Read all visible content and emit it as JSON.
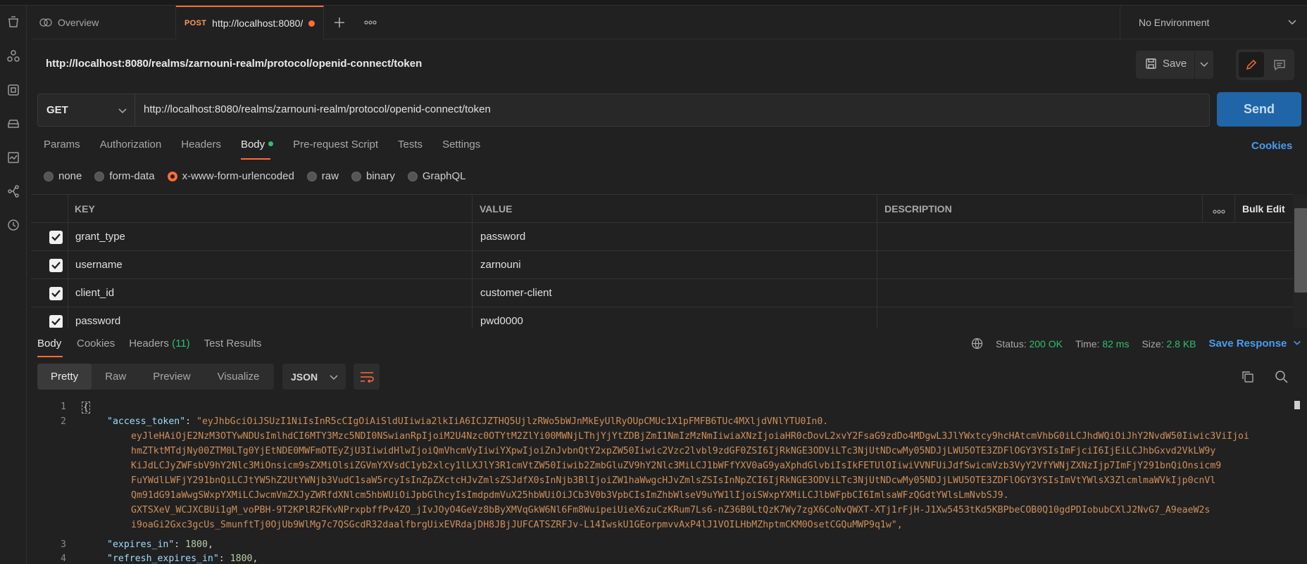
{
  "tabs": [
    {
      "label": "Overview"
    },
    {
      "method": "POST",
      "label": "http://localhost:8080/"
    }
  ],
  "environment": "No Environment",
  "request_title": "http://localhost:8080/realms/zarnouni-realm/protocol/openid-connect/token",
  "save_label": "Save",
  "method": "GET",
  "url": "http://localhost:8080/realms/zarnouni-realm/protocol/openid-connect/token",
  "send_label": "Send",
  "req_tabs": [
    "Params",
    "Authorization",
    "Headers",
    "Body",
    "Pre-request Script",
    "Tests",
    "Settings"
  ],
  "cookies_link": "Cookies",
  "body_types": [
    "none",
    "form-data",
    "x-www-form-urlencoded",
    "raw",
    "binary",
    "GraphQL"
  ],
  "selected_body_type": "x-www-form-urlencoded",
  "table": {
    "headers": [
      "KEY",
      "VALUE",
      "DESCRIPTION"
    ],
    "bulk_edit": "Bulk Edit",
    "rows": [
      {
        "key": "grant_type",
        "value": "password",
        "checked": true
      },
      {
        "key": "username",
        "value": "zarnouni",
        "checked": true
      },
      {
        "key": "client_id",
        "value": "customer-client",
        "checked": true
      },
      {
        "key": "password",
        "value": "pwd0000",
        "checked": true
      }
    ]
  },
  "response": {
    "tabs": [
      "Body",
      "Cookies",
      "Headers",
      "Test Results"
    ],
    "headers_count": "(11)",
    "status_label": "Status:",
    "status_value": "200 OK",
    "time_label": "Time:",
    "time_value": "82 ms",
    "size_label": "Size:",
    "size_value": "2.8 KB",
    "save_response": "Save Response",
    "views": [
      "Pretty",
      "Raw",
      "Preview",
      "Visualize"
    ],
    "format": "JSON"
  },
  "code": {
    "line_numbers": [
      "1",
      "2",
      "3",
      "4"
    ],
    "open_brace": "{",
    "access_token_key": "\"access_token\"",
    "access_token_lines": [
      "\"eyJhbGciOiJSUzI1NiIsInR5cCIgOiAiSldUIiwia2lkIiA6ICJZTHQ5UjlzRWo5bWJnMkEyUlRyOUpCMUc1X1pFMFB6TUc4MXljdVNlYTU0In0.",
      "eyJleHAiOjE2NzM3OTYwNDUsImlhdCI6MTY3Mzc5NDI0NSwianRpIjoiM2U4Nzc0OTYtM2ZlYi00MWNjLThjYjYtZDBjZmI1NmIzMzNmIiwiaXNzIjoiaHR0cDovL2xvY2FsaG9zdDo4MDgwL3JlYWxtcy9hcHAtcmVhbG0iLCJhdWQiOiJhY2NvdW50Iiwic3ViIjoi",
      "hmZTktMTdjNy00ZTM0LTg0YjEtNDE0MWFmOTEyZjU3IiwidHlwIjoiQmVhcmVyIiwiYXpwIjoiZnJvbnQtY2xpZW50Iiwic2Vzc2lvbl9zdGF0ZSI6IjRkNGE3ODViLTc3NjUtNDcwMy05NDJjLWU5OTE3ZDFlOGY3YSIsImFjciI6IjEiLCJhbGxvd2VkLW9y",
      "KiJdLCJyZWFsbV9hY2Nlc3MiOnsicm9sZXMiOlsiZGVmYXVsdC1yb2xlcy1lLXJlY3R1cmVtZW50Iiwib2ZmbGluZV9hY2Nlc3MiLCJ1bWFfYXV0aG9yaXphdGlvbiIsIkFETUlOIiwiVVNFUiJdfSwicmVzb3VyY2VfYWNjZXNzIjp7ImFjY291bnQiOnsicm9",
      "FuYWdlLWFjY291bnQiLCJtYW5hZ2UtYWNjb3VudC1saW5rcyIsInZpZXctcHJvZmlsZSJdfX0sInNjb3BlIjoiZW1haWwgcHJvZmlsZSIsInNpZCI6IjRkNGE3ODViLTc3NjUtNDcwMy05NDJjLWU5OTE3ZDFlOGY3YSIsImVtYWlsX3ZlcmlmaWVkIjp0cnVl",
      "Qm91dG91aWwgSWxpYXMiLCJwcmVmZXJyZWRfdXNlcm5hbWUiOiJpbGlhcyIsImdpdmVuX25hbWUiOiJCb3V0b3VpbCIsImZhbWlseV9uYW1lIjoiSWxpYXMiLCJlbWFpbCI6ImlsaWFzQGdtYWlsLmNvbSJ9.",
      "GXTSXeV_WCJXCBUi1gM_voPBH-9T2KPlR2FKvNPrxpbffPv4ZO_jIvJOyO4GeVz8bByXMVqGkW6Nl6Fm8WuipeiUieX6zuCzKRum7Ls6-nZ36B0LtQzK7Wy7zgX6CoNvQWXT-XTj1rFjH-J1Xw5453tKd5KBPbeCOB0Q10gdPDIobubCXlJ2NvG7_A9eaeW2s",
      "i9oaGi2Gxc3gcUs_SmunftTj0OjUb9WlMg7c7QSGcdR32daalfbrgUixEVRdajDH8JBjJUFCATSZRFJv-L14IwskU1GEorpmvvAxP4lJ1VOILHbMZhptmCKM0OsetCGQuMWP9q1w\","
    ],
    "expires_in_key": "\"expires_in\"",
    "expires_in_value": "1800",
    "refresh_expires_in_key": "\"refresh_expires_in\"",
    "refresh_expires_in_value": "1800"
  },
  "colors": {
    "accent": "#ff6c37",
    "send": "#1f65a8",
    "link": "#4a9cf0",
    "ok": "#2fbf71"
  }
}
